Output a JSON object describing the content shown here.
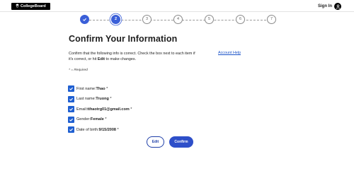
{
  "header": {
    "logo_text": "CollegeBoard",
    "signin_label": "Sign In"
  },
  "stepper": {
    "steps": [
      {
        "label": "✓",
        "state": "done"
      },
      {
        "label": "2",
        "state": "active"
      },
      {
        "label": "3",
        "state": "upcoming"
      },
      {
        "label": "4",
        "state": "upcoming"
      },
      {
        "label": "5",
        "state": "upcoming"
      },
      {
        "label": "6",
        "state": "upcoming"
      },
      {
        "label": "7",
        "state": "upcoming"
      }
    ]
  },
  "main": {
    "title": "Confirm Your Information",
    "instructions_part1": "Confirm that the following info is correct. Check the box next to each item if it's correct, or hit ",
    "instructions_edit": "Edit",
    "instructions_part2": " to make changes.",
    "account_help": "Account Help",
    "required_note": "* = Required"
  },
  "fields": [
    {
      "label": "First name:",
      "value": "Thao",
      "required": " *",
      "checked": true
    },
    {
      "label": "Last name:",
      "value": "Truong",
      "required": " *",
      "checked": true
    },
    {
      "label": "Email:",
      "value": "tthaotrg01@gmail.com",
      "required": " *",
      "checked": true
    },
    {
      "label": "Gender:",
      "value": "Female",
      "required": " *",
      "checked": true
    },
    {
      "label": "Date of birth:",
      "value": "9/15/2008",
      "required": " *",
      "checked": true
    }
  ],
  "actions": {
    "edit_label": "Edit",
    "confirm_label": "Confirm"
  },
  "colors": {
    "accent": "#3a5fd8",
    "checkbox": "#1f5fd1",
    "link": "#1a52c8"
  },
  "icons": {
    "logo": "acorn-icon",
    "user": "user-icon",
    "check": "checkmark-icon"
  }
}
